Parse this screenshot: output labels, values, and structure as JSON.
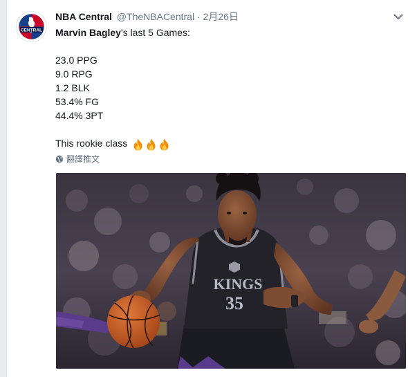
{
  "tweet": {
    "display_name": "NBA Central",
    "handle": "@TheNBACentral",
    "separator": "·",
    "date": "2月26日",
    "intro_name": "Marvin Bagley",
    "intro_rest": "'s last 5 Games:",
    "stats": [
      "23.0 PPG",
      "9.0 RPG",
      "1.2 BLK",
      "53.4% FG",
      "44.4% 3PT"
    ],
    "closing": "This rookie class",
    "translate_label": "翻譯推文",
    "icons": [
      "nba-central-logo",
      "chevron-down-icon",
      "fire-emoji",
      "globe-icon"
    ]
  },
  "logo": {
    "text": "CENTRAL"
  },
  "jersey": {
    "team": "KINGS",
    "number": "35"
  }
}
